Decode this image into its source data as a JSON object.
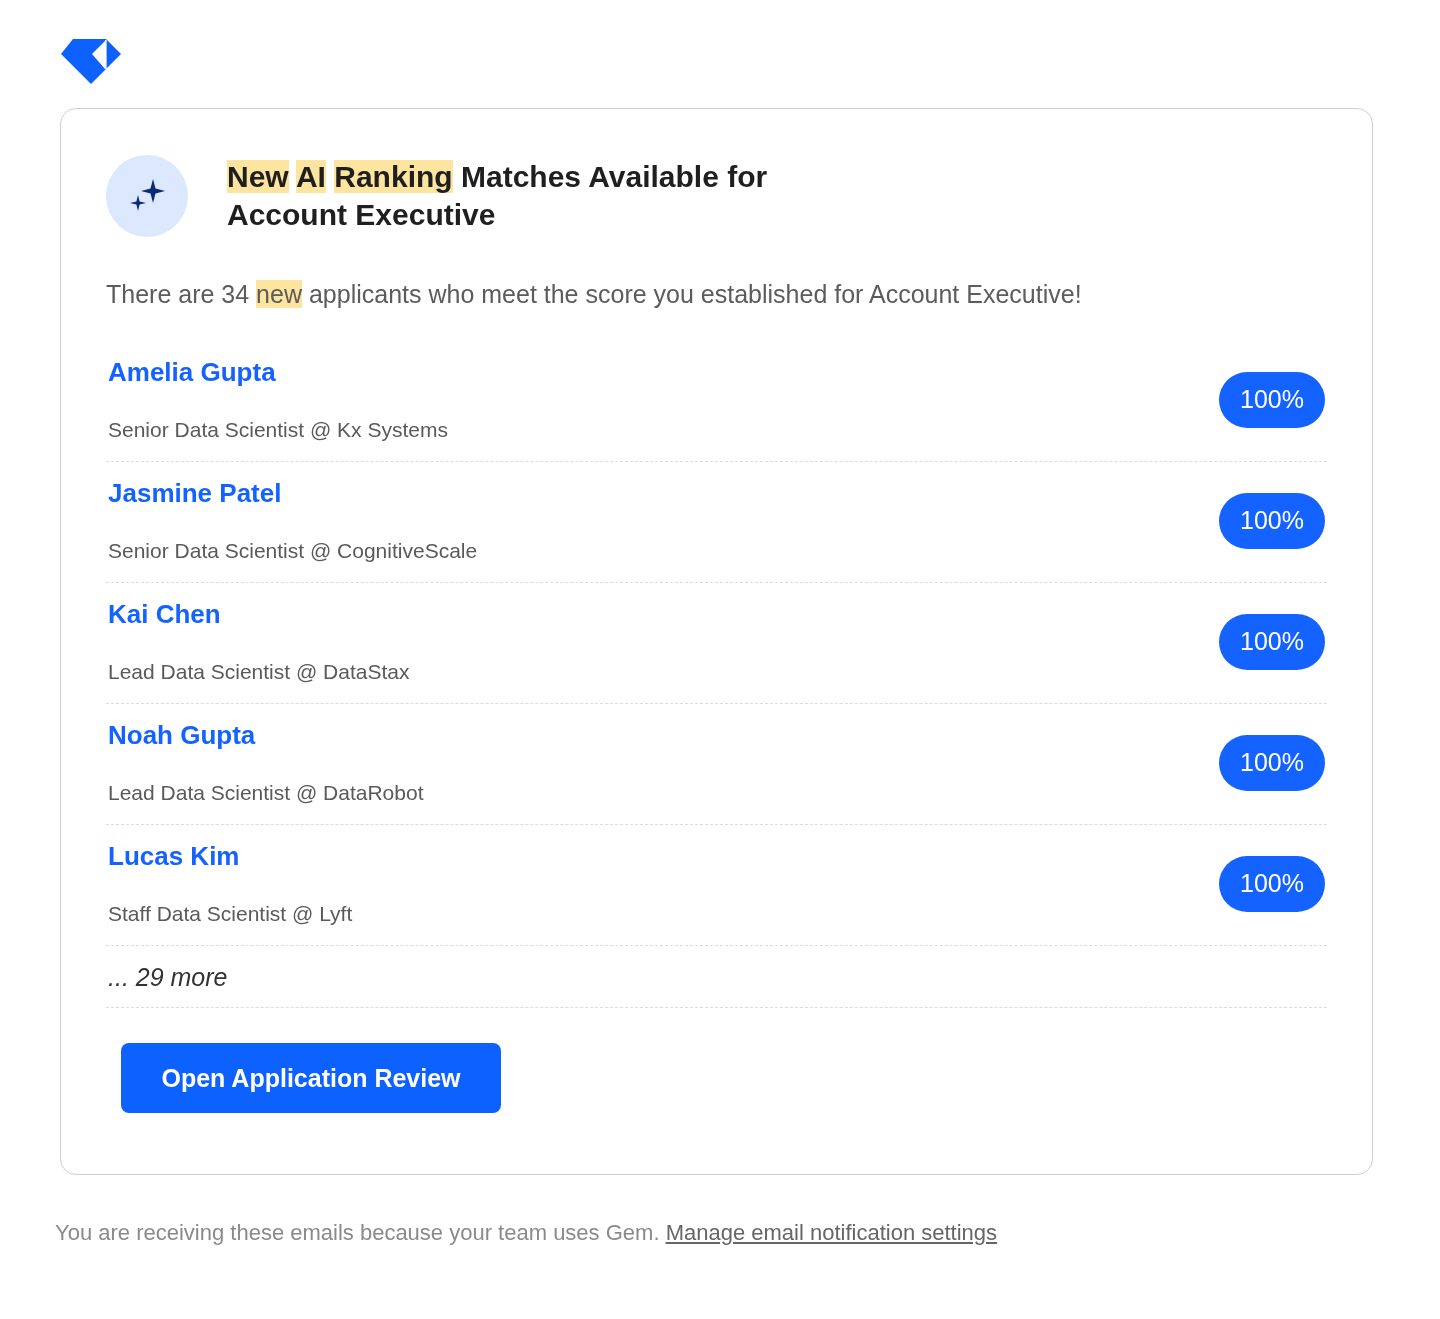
{
  "card": {
    "title": [
      {
        "text": "New",
        "highlighted": true
      },
      {
        "text": "AI",
        "highlighted": true
      },
      {
        "text": "Ranking",
        "highlighted": true
      },
      {
        "text": "Matches Available for Account Executive",
        "highlighted": false
      }
    ],
    "intro": [
      {
        "text": "There are 34",
        "highlighted": false
      },
      {
        "text": "new",
        "highlighted": true
      },
      {
        "text": "applicants who meet the score you established for Account Executive!",
        "highlighted": false
      }
    ],
    "applicants": [
      {
        "name": "Amelia Gupta",
        "position": "Senior Data Scientist @ Kx Systems",
        "score": "100%"
      },
      {
        "name": "Jasmine Patel",
        "position": "Senior Data Scientist @ CognitiveScale",
        "score": "100%"
      },
      {
        "name": "Kai Chen",
        "position": "Lead Data Scientist @ DataStax",
        "score": "100%"
      },
      {
        "name": "Noah Gupta",
        "position": "Lead Data Scientist @ DataRobot",
        "score": "100%"
      },
      {
        "name": "Lucas Kim",
        "position": "Staff Data Scientist @ Lyft",
        "score": "100%"
      }
    ],
    "more": "... 29 more",
    "button": "Open Application Review"
  },
  "footer": {
    "text": "You are receiving these emails because your team uses Gem.",
    "link": "Manage email notification settings"
  }
}
